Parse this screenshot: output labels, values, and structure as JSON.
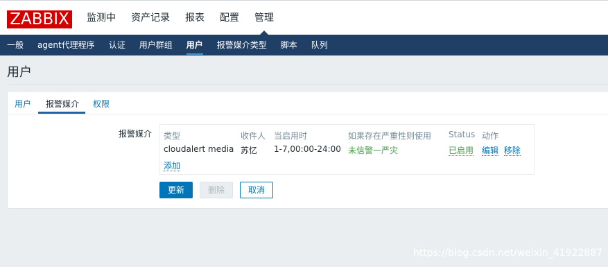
{
  "logo": "ZABBIX",
  "main_menu": [
    "监测中",
    "资产记录",
    "报表",
    "配置",
    "管理"
  ],
  "main_menu_active": "管理",
  "sub_menu": [
    "一般",
    "agent代理程序",
    "认证",
    "用户群组",
    "用户",
    "报警媒介类型",
    "脚本",
    "队列"
  ],
  "sub_menu_active": "用户",
  "page_title": "用户",
  "tabs": [
    "用户",
    "报警媒介",
    "权限"
  ],
  "active_tab": "报警媒介",
  "form": {
    "media_label": "报警媒介",
    "columns": {
      "type": "类型",
      "sendto": "收件人",
      "when_active": "当启用时",
      "severity": "如果存在严重性则使用",
      "status": "Status",
      "action": "动作"
    },
    "row": {
      "type": "cloudalert media",
      "sendto": "苏忆",
      "when_active": "1-7,00:00-24:00",
      "severity": "未信警一严灾",
      "status": "已启用",
      "edit": "编辑",
      "remove": "移除"
    },
    "add_link": "添加"
  },
  "buttons": {
    "update": "更新",
    "delete": "删除",
    "cancel": "取消"
  },
  "colors": {
    "brand": "#d40000",
    "nav_bg": "#1f3f66",
    "link": "#0275b8",
    "enabled": "#429e47"
  },
  "watermark": "https://blog.csdn.net/weixin_41922887"
}
